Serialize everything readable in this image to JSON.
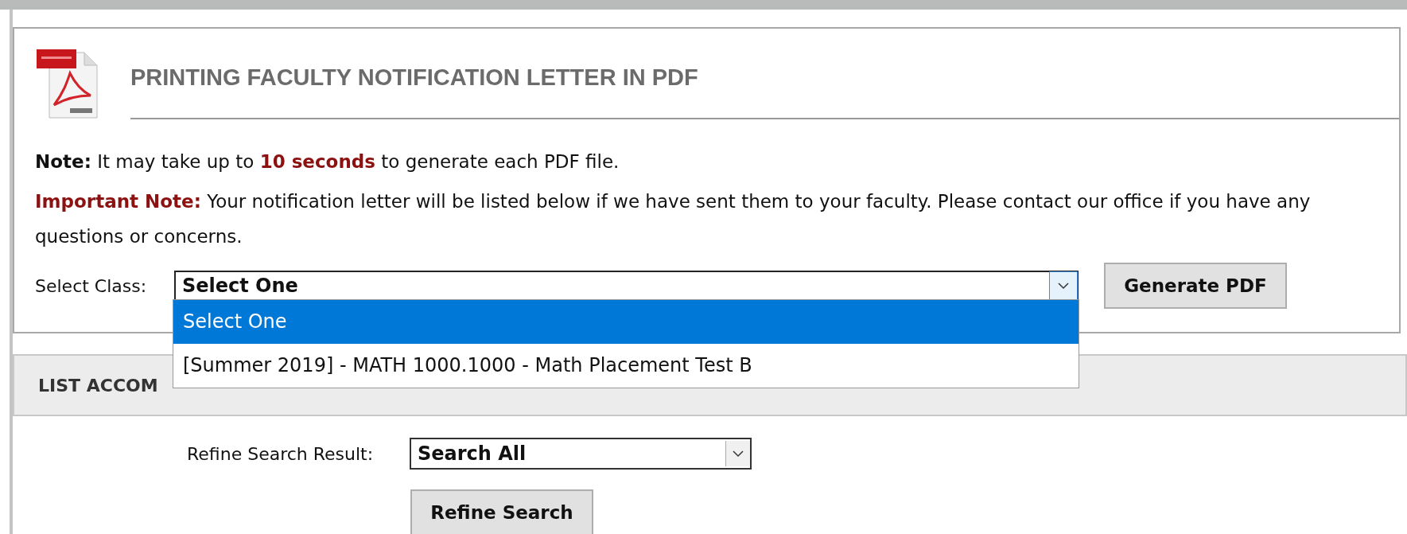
{
  "pdf_section": {
    "title": "PRINTING FACULTY NOTIFICATION LETTER IN PDF",
    "note": "**Note:** It may take up to **10 seconds** to generate each PDF file.",
    "important_note": "**Important Note:** Your notification letter will be listed below if we have sent them to your faculty. Please contact our office if you have any questions or concerns.",
    "select_class": {
      "label": "Select Class:",
      "value": "Select One",
      "expanded": true,
      "options": [
        {
          "label": "Select One",
          "selected": true
        },
        {
          "label": "[Summer 2019] - MATH 1000.1000 - Math Placement Test B",
          "selected": false
        }
      ]
    },
    "generate_button": "Generate PDF"
  },
  "list_section": {
    "title": "LIST ACCOM",
    "refine": {
      "label": "Refine Search Result:",
      "value": "Search All"
    },
    "refine_button": "Refine Search"
  }
}
